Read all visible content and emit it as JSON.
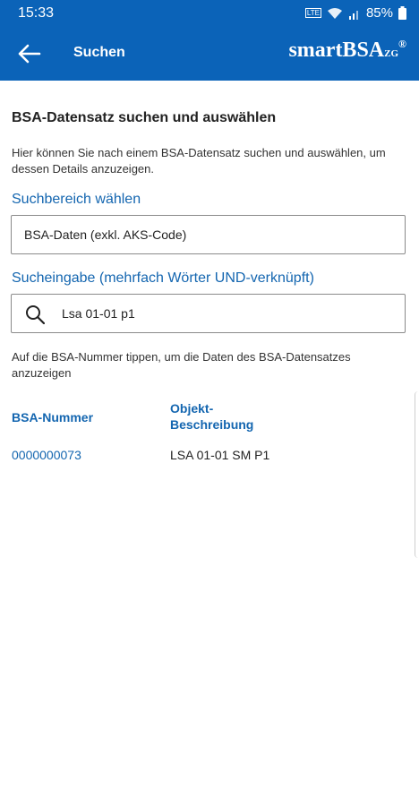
{
  "statusbar": {
    "time": "15:33",
    "battery": "85%",
    "network": "LTE"
  },
  "appbar": {
    "title": "Suchen",
    "logo_main": "smartBSA",
    "logo_sub": "ZG",
    "logo_reg": "®"
  },
  "main": {
    "heading": "BSA-Datensatz suchen und auswählen",
    "intro": "Hier können Sie nach einem BSA-Datensatz suchen und auswählen, um dessen Details anzuzeigen.",
    "scope_label": "Suchbereich wählen",
    "scope_value": "BSA-Daten (exkl. AKS-Code)",
    "search_label": "Sucheingabe (mehrfach Wörter UND-verknüpft)",
    "search_value": "Lsa 01-01 p1",
    "hint": "Auf die BSA-Nummer tippen, um die Daten des BSA-Datensatzes anzuzeigen"
  },
  "table": {
    "headers": [
      "BSA-Nummer",
      "Objekt-\nBeschreibung"
    ],
    "rows": [
      {
        "number": "0000000073",
        "description": "LSA 01-01 SM P1"
      }
    ]
  },
  "icons": {
    "back": "arrow-left-icon",
    "search": "search-icon",
    "wifi": "wifi-icon",
    "signal": "signal-icon",
    "battery": "battery-icon"
  },
  "colors": {
    "primary": "#0b63b8",
    "accent_text": "#1466b0"
  }
}
